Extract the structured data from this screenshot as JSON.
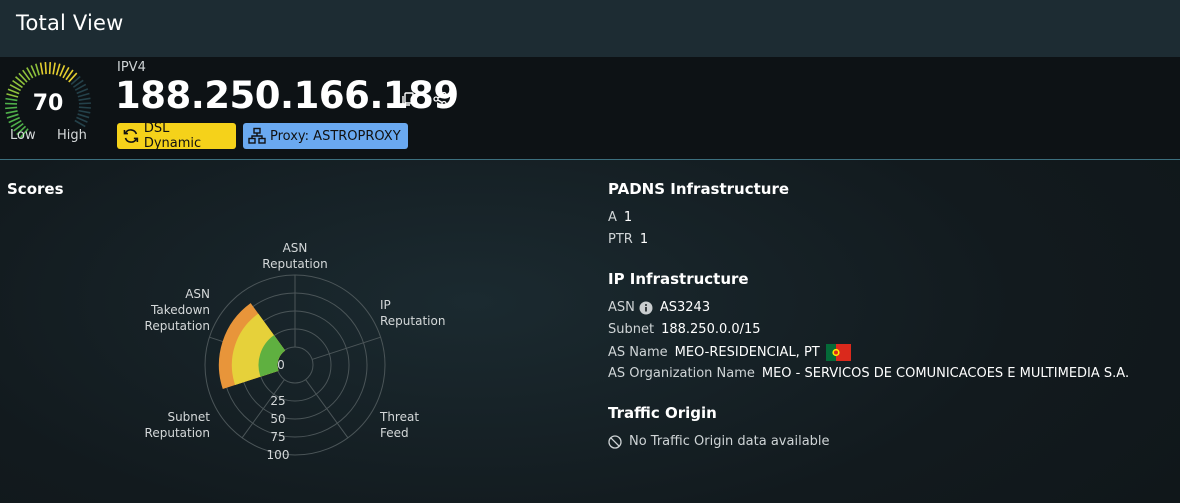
{
  "page": {
    "title": "Total View"
  },
  "header": {
    "score": "70",
    "score_low_label": "Low",
    "score_high_label": "High",
    "ip_type": "IPV4",
    "ip_address": "188.250.166.189",
    "badges": [
      {
        "label": "DSL Dynamic",
        "icon": "refresh-icon",
        "color": "#f5d21a"
      },
      {
        "label": "Proxy: ASTROPROXY",
        "icon": "network-icon",
        "color": "#6aa9f0"
      }
    ]
  },
  "scores": {
    "title": "Scores",
    "chart_data": {
      "type": "radar",
      "axes": [
        "ASN Reputation",
        "IP Reputation",
        "Threat Feed",
        "Subnet Reputation",
        "ASN Takedown Reputation"
      ],
      "axis_label_lines": [
        [
          "ASN",
          "Reputation"
        ],
        [
          "IP",
          "Reputation"
        ],
        [
          "Threat",
          "Feed"
        ],
        [
          "Subnet",
          "Reputation"
        ],
        [
          "ASN",
          "Takedown",
          "Reputation"
        ]
      ],
      "ticks": [
        "0",
        "25",
        "50",
        "75",
        "100"
      ],
      "rlim": [
        0,
        100
      ],
      "inner_offset_fraction": 0.2,
      "series": [
        {
          "values": [
            0,
            0,
            0,
            0,
            80
          ],
          "color": "#e8953a"
        },
        {
          "values": [
            0,
            0,
            0,
            0,
            62
          ],
          "color": "#e6d13a"
        },
        {
          "values": [
            0,
            0,
            0,
            0,
            25
          ],
          "color": "#5fb040"
        }
      ]
    }
  },
  "padns": {
    "title": "PADNS Infrastructure",
    "rows": [
      {
        "key": "A",
        "value": "1"
      },
      {
        "key": "PTR",
        "value": "1"
      }
    ]
  },
  "ip_infra": {
    "title": "IP Infrastructure",
    "asn_key": "ASN",
    "asn_value": "AS3243",
    "subnet_key": "Subnet",
    "subnet_value": "188.250.0.0/15",
    "as_name_key": "AS Name",
    "as_name_value": "MEO-RESIDENCIAL, PT",
    "as_org_key": "AS Organization Name",
    "as_org_value": "MEO - SERVICOS DE COMUNICACOES E MULTIMEDIA S.A."
  },
  "traffic": {
    "title": "Traffic Origin",
    "empty_message": "No Traffic Origin data available"
  },
  "colors": {
    "title_bar": "#1d2c33",
    "header_bg": "#0d1215",
    "accent_line": "#3c6f7e",
    "badge_dsl": "#f5d21a",
    "badge_proxy": "#6aa9f0"
  }
}
